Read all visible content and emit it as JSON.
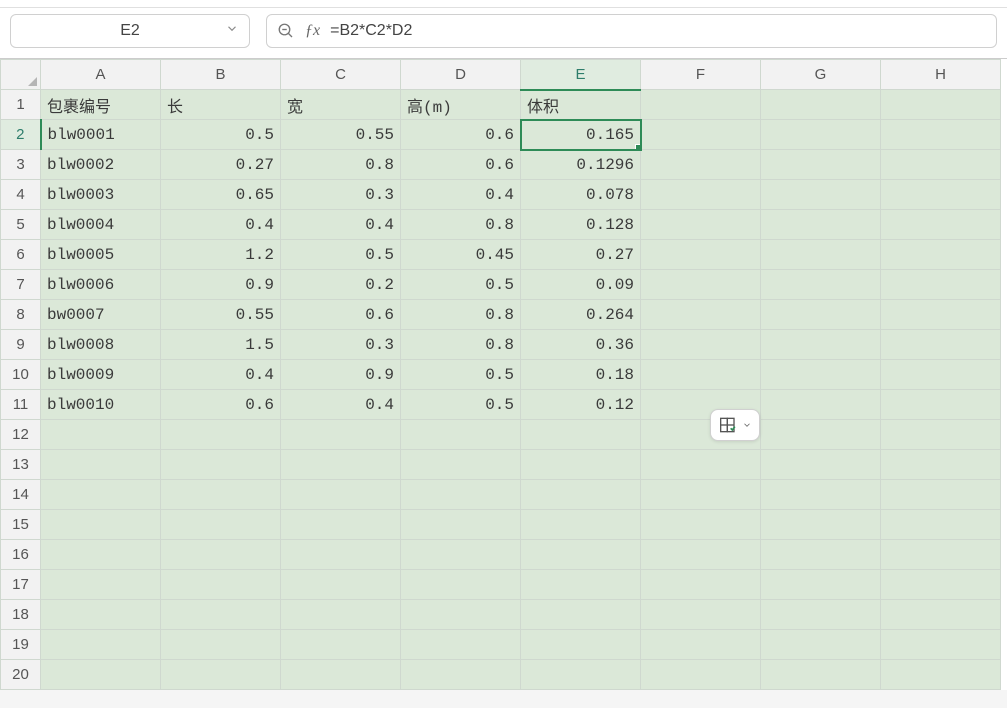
{
  "name_box": {
    "value": "E2"
  },
  "formula_bar": {
    "formula": "=B2*C2*D2"
  },
  "columns": [
    "A",
    "B",
    "C",
    "D",
    "E",
    "F",
    "G",
    "H"
  ],
  "row_count": 20,
  "active_cell": {
    "row": 2,
    "col": "E"
  },
  "headers": {
    "A": "包裹编号",
    "B": "长",
    "C": "宽",
    "D": "高(m)",
    "E": "体积"
  },
  "rows": [
    {
      "A": "blw0001",
      "B": "0.5",
      "C": "0.55",
      "D": "0.6",
      "E": "0.165"
    },
    {
      "A": "blw0002",
      "B": "0.27",
      "C": "0.8",
      "D": "0.6",
      "E": "0.1296"
    },
    {
      "A": "blw0003",
      "B": "0.65",
      "C": "0.3",
      "D": "0.4",
      "E": "0.078"
    },
    {
      "A": "blw0004",
      "B": "0.4",
      "C": "0.4",
      "D": "0.8",
      "E": "0.128"
    },
    {
      "A": "blw0005",
      "B": "1.2",
      "C": "0.5",
      "D": "0.45",
      "E": "0.27"
    },
    {
      "A": "blw0006",
      "B": "0.9",
      "C": "0.2",
      "D": "0.5",
      "E": "0.09"
    },
    {
      "A": "bw0007",
      "B": "0.55",
      "C": "0.6",
      "D": "0.8",
      "E": "0.264"
    },
    {
      "A": "blw0008",
      "B": "1.5",
      "C": "0.3",
      "D": "0.8",
      "E": "0.36"
    },
    {
      "A": "blw0009",
      "B": "0.4",
      "C": "0.9",
      "D": "0.5",
      "E": "0.18"
    },
    {
      "A": "blw0010",
      "B": "0.6",
      "C": "0.4",
      "D": "0.5",
      "E": "0.12"
    }
  ],
  "chart_data": {
    "type": "table",
    "columns": [
      "包裹编号",
      "长",
      "宽",
      "高(m)",
      "体积"
    ],
    "rows": [
      [
        "blw0001",
        0.5,
        0.55,
        0.6,
        0.165
      ],
      [
        "blw0002",
        0.27,
        0.8,
        0.6,
        0.1296
      ],
      [
        "blw0003",
        0.65,
        0.3,
        0.4,
        0.078
      ],
      [
        "blw0004",
        0.4,
        0.4,
        0.8,
        0.128
      ],
      [
        "blw0005",
        1.2,
        0.5,
        0.45,
        0.27
      ],
      [
        "blw0006",
        0.9,
        0.2,
        0.5,
        0.09
      ],
      [
        "bw0007",
        0.55,
        0.6,
        0.8,
        0.264
      ],
      [
        "blw0008",
        1.5,
        0.3,
        0.8,
        0.36
      ],
      [
        "blw0009",
        0.4,
        0.9,
        0.5,
        0.18
      ],
      [
        "blw0010",
        0.6,
        0.4,
        0.5,
        0.12
      ]
    ]
  }
}
